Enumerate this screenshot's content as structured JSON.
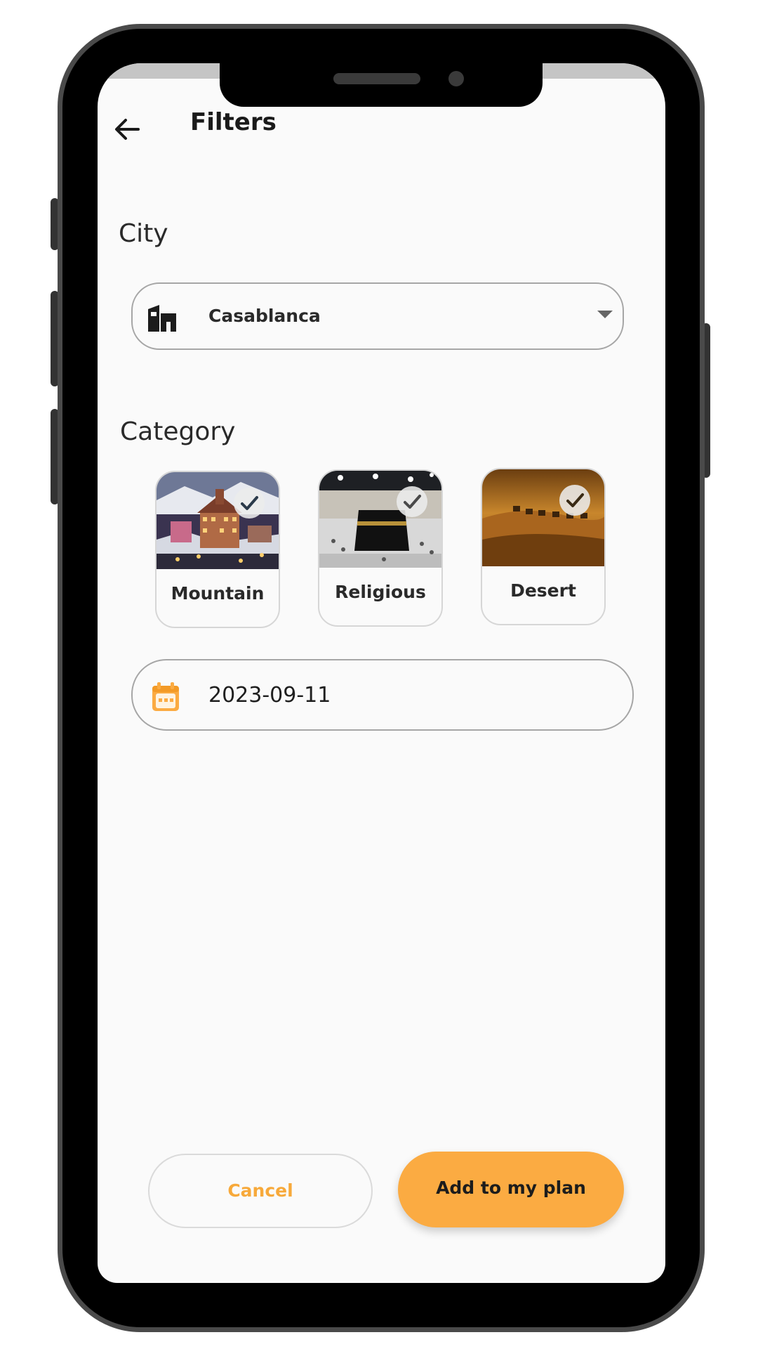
{
  "header": {
    "title": "Filters",
    "back_icon": "arrow-left-icon"
  },
  "city": {
    "label": "City",
    "selected": "Casablanca",
    "icon": "city-buildings-icon",
    "dropdown_icon": "caret-down-icon"
  },
  "category": {
    "label": "Category",
    "items": [
      {
        "label": "Mountain",
        "selected": true,
        "icon": "check-icon"
      },
      {
        "label": "Religious",
        "selected": true,
        "icon": "check-icon"
      },
      {
        "label": "Desert",
        "selected": true,
        "icon": "check-icon"
      }
    ]
  },
  "date": {
    "value": "2023-09-11",
    "icon": "calendar-icon"
  },
  "actions": {
    "cancel_label": "Cancel",
    "primary_label": "Add to my plan"
  },
  "colors": {
    "accent": "#fbab42",
    "cancel_text": "#f7a93a",
    "background": "#fafafa",
    "text": "#1a1a1a"
  }
}
